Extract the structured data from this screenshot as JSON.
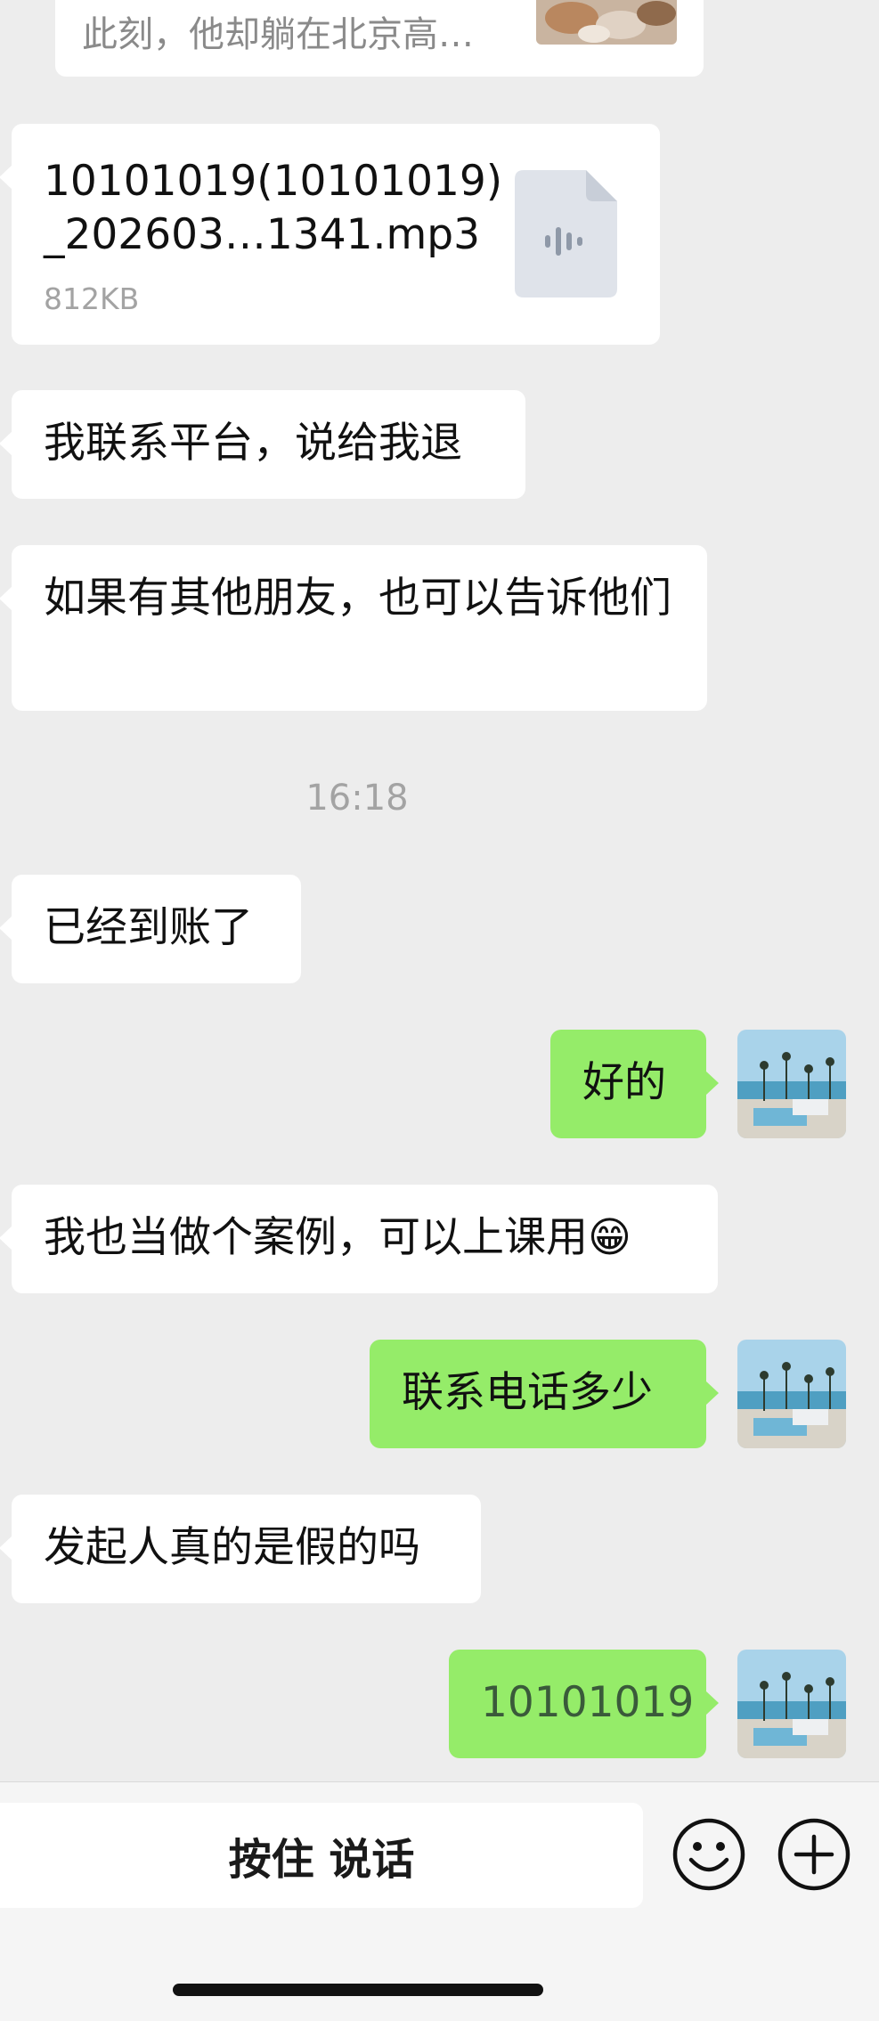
{
  "shared_card": {
    "description": "此刻，他却躺在北京高…"
  },
  "file_message": {
    "name_line1": "10101019(10101019)",
    "name_line2": "_202603…1341.mp3",
    "size": "812KB"
  },
  "messages": [
    {
      "side": "left",
      "text": "我联系平台，说给我退"
    },
    {
      "side": "left",
      "text": "如果有其他朋友，也可以告诉他们"
    },
    {
      "side": "left",
      "text": "已经到账了"
    },
    {
      "side": "right",
      "text": "好的"
    },
    {
      "side": "left",
      "text": "我也当做个案例，可以上课用😁"
    },
    {
      "side": "right",
      "text": "联系电话多少"
    },
    {
      "side": "left",
      "text": "发起人真的是假的吗"
    },
    {
      "side": "right",
      "text": "10101019"
    }
  ],
  "timestamp": "16:18",
  "input_bar": {
    "hold_to_talk_label": "按住 说话",
    "emoji_icon": "emoji-icon",
    "plus_icon": "plus-icon"
  },
  "colors": {
    "background": "#ededed",
    "outgoing_bubble": "#95ec69",
    "incoming_bubble": "#ffffff"
  }
}
